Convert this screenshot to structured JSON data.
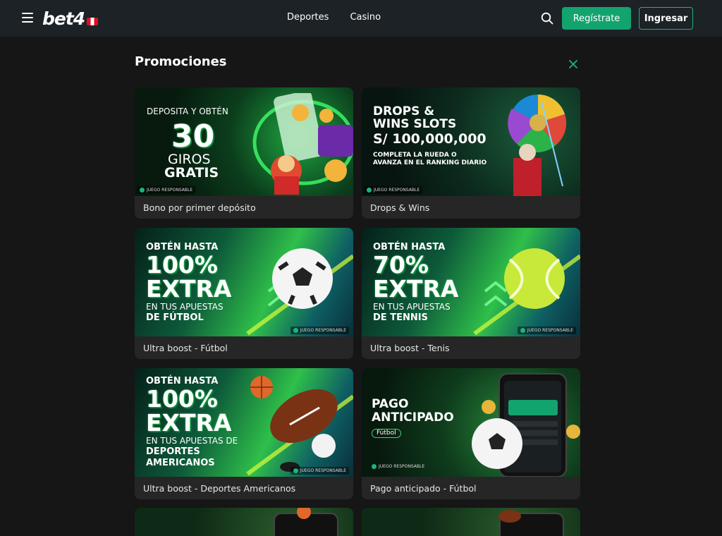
{
  "header": {
    "logo_text": "bet4",
    "nav": [
      {
        "label": "Deportes"
      },
      {
        "label": "Casino"
      }
    ],
    "register_label": "Regístrate",
    "login_label": "Ingresar"
  },
  "page": {
    "title": "Promociones"
  },
  "colors": {
    "accent": "#13a36f",
    "background": "#161616",
    "topbar": "#1d2226",
    "card": "#262626"
  },
  "promos": [
    {
      "label": "Bono por primer depósito",
      "banner": {
        "line1": "DEPOSITA Y OBTÉN",
        "big": "30",
        "line2": "GIROS",
        "line3": "GRATIS",
        "badge": "JUEGO RESPONSABLE"
      }
    },
    {
      "label": "Drops & Wins",
      "banner": {
        "line1": "DROPS &",
        "line2": "WINS SLOTS",
        "big": "S/ 100,000,000",
        "line3": "COMPLETA LA RUEDA O",
        "line4": "AVANZA EN EL RANKING DIARIO",
        "badge": "JUEGO RESPONSABLE"
      }
    },
    {
      "label": "Ultra boost - Fútbol",
      "banner": {
        "line1": "OBTÉN HASTA",
        "big": "100%",
        "big2": "EXTRA",
        "line3": "EN TUS APUESTAS",
        "line4": "DE FÚTBOL",
        "badge": "JUEGO RESPONSABLE"
      }
    },
    {
      "label": "Ultra boost - Tenis",
      "banner": {
        "line1": "OBTÉN HASTA",
        "big": "70%",
        "big2": "EXTRA",
        "line3": "EN TUS APUESTAS",
        "line4": "DE TENNIS",
        "badge": "JUEGO RESPONSABLE"
      }
    },
    {
      "label": "Ultra boost - Deportes Americanos",
      "banner": {
        "line1": "OBTÉN HASTA",
        "big": "100%",
        "big2": "EXTRA",
        "line3": "EN TUS APUESTAS DE",
        "line4": "DEPORTES",
        "line5": "AMERICANOS",
        "badge": "JUEGO RESPONSABLE"
      }
    },
    {
      "label": "Pago anticipado - Fútbol",
      "banner": {
        "line1": "PAGO",
        "line2": "ANTICIPADO",
        "tag": "Fútbol",
        "badge": "JUEGO RESPONSABLE"
      }
    }
  ]
}
